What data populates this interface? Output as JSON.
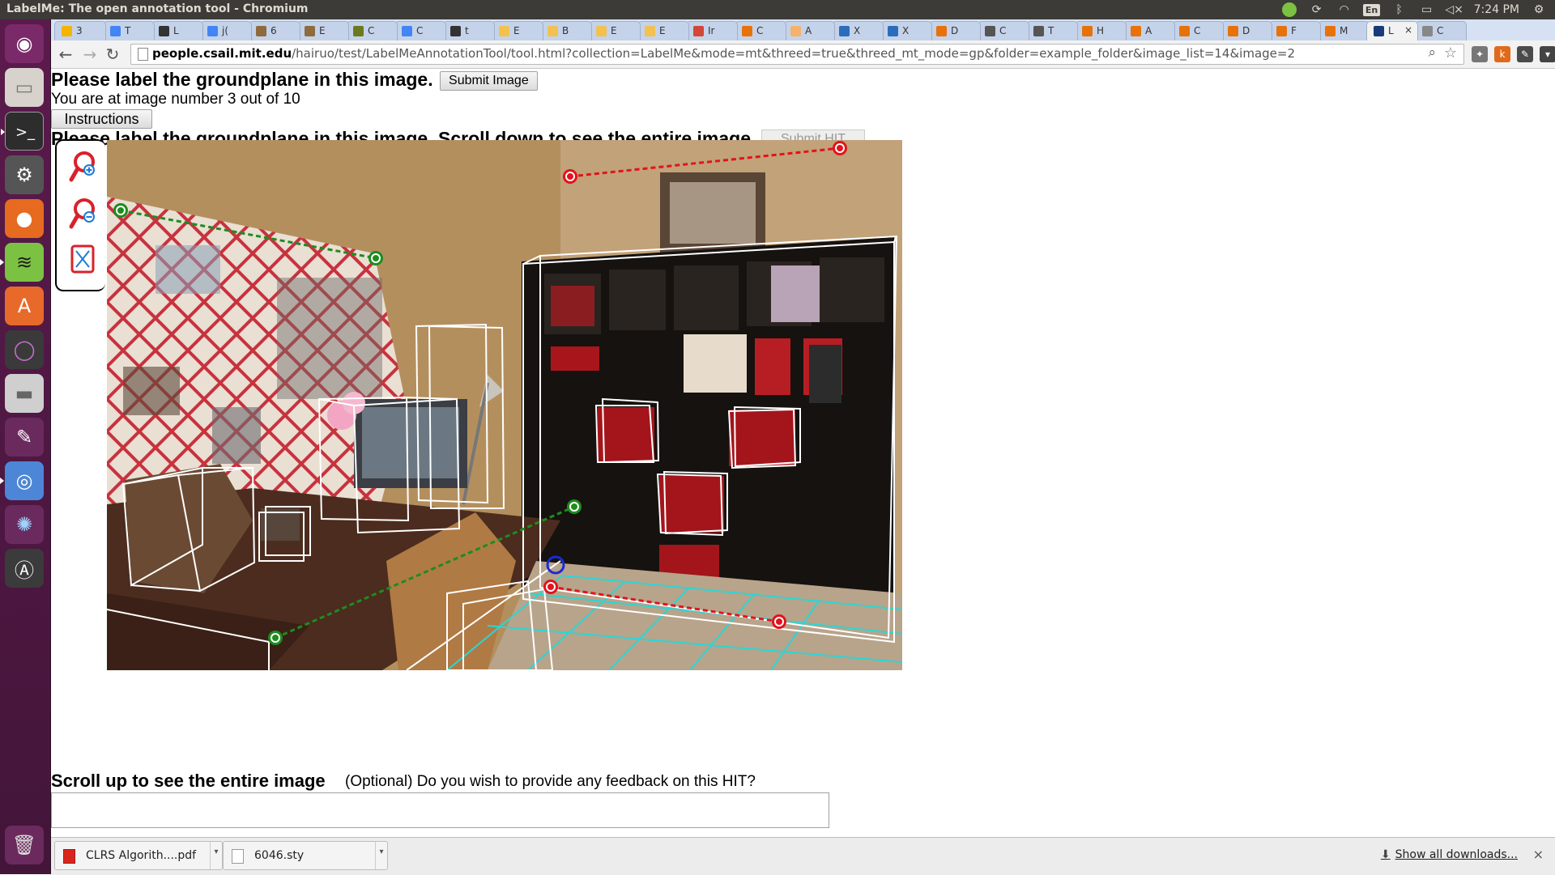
{
  "window": {
    "title": "LabelMe: The open annotation tool - Chromium"
  },
  "system_tray": {
    "clock": "7:24 PM",
    "keyboard": "En"
  },
  "tabs": [
    {
      "label": "3",
      "color": "#f4b400"
    },
    {
      "label": "T",
      "color": "#4285f4"
    },
    {
      "label": "L",
      "color": "#333333"
    },
    {
      "label": "j(",
      "color": "#4285f4"
    },
    {
      "label": "6",
      "color": "#8e6b3d"
    },
    {
      "label": "E",
      "color": "#8e6b3d"
    },
    {
      "label": "C",
      "color": "#6b7a1f"
    },
    {
      "label": "C",
      "color": "#4285f4"
    },
    {
      "label": "t",
      "color": "#333333"
    },
    {
      "label": "E",
      "color": "#f2c14e"
    },
    {
      "label": "B",
      "color": "#f2c14e"
    },
    {
      "label": "E",
      "color": "#f2c14e"
    },
    {
      "label": "E",
      "color": "#f2c14e"
    },
    {
      "label": "Ir",
      "color": "#d44638"
    },
    {
      "label": "C",
      "color": "#e8710a"
    },
    {
      "label": "A",
      "color": "#f6b26b"
    },
    {
      "label": "X",
      "color": "#2a6ebb"
    },
    {
      "label": "X",
      "color": "#2a6ebb"
    },
    {
      "label": "D",
      "color": "#e8710a"
    },
    {
      "label": "C",
      "color": "#555555"
    },
    {
      "label": "T",
      "color": "#555555"
    },
    {
      "label": "H",
      "color": "#e8710a"
    },
    {
      "label": "A",
      "color": "#e8710a"
    },
    {
      "label": "C",
      "color": "#e8710a"
    },
    {
      "label": "D",
      "color": "#e8710a"
    },
    {
      "label": "F",
      "color": "#e8710a"
    },
    {
      "label": "M",
      "color": "#e8710a"
    },
    {
      "label": "L",
      "color": "#1a3b7a",
      "active": true
    },
    {
      "label": "C",
      "color": "#888888"
    }
  ],
  "toolbar": {
    "url_host": "people.csail.mit.edu",
    "url_path": "/hairuo/test/LabelMeAnnotationTool/tool.html?collection=LabelMe&mode=mt&threed=true&threed_mt_mode=gp&folder=example_folder&image_list=14&image=2"
  },
  "page": {
    "heading": "Please label the groundplane in this image.",
    "submit_image": "Submit Image",
    "counter": "You are at image number 3 out of 10",
    "instructions": "Instructions",
    "heading2": "Please label the groundplane in this image. Scroll down to see the entire image.",
    "submit_hit": "Submit HIT",
    "scroll_note": "Scroll up to see the entire image",
    "feedback_question": "(Optional) Do you wish to provide any feedback on this HIT?",
    "feedback_value": ""
  },
  "downloads": {
    "items": [
      {
        "name": "CLRS Algorith....pdf",
        "type": "pdf"
      },
      {
        "name": "6046.sty",
        "type": "file"
      }
    ],
    "show_all": "Show all downloads..."
  },
  "colors": {
    "launcher_bg": "#5b1a4d",
    "annotation_red": "#e3121b",
    "annotation_green": "#1e8c1e",
    "groundplane_cyan": "#2cd5d5",
    "cuboid_white": "#ffffff",
    "vanish_blue": "#1a2bd6"
  }
}
